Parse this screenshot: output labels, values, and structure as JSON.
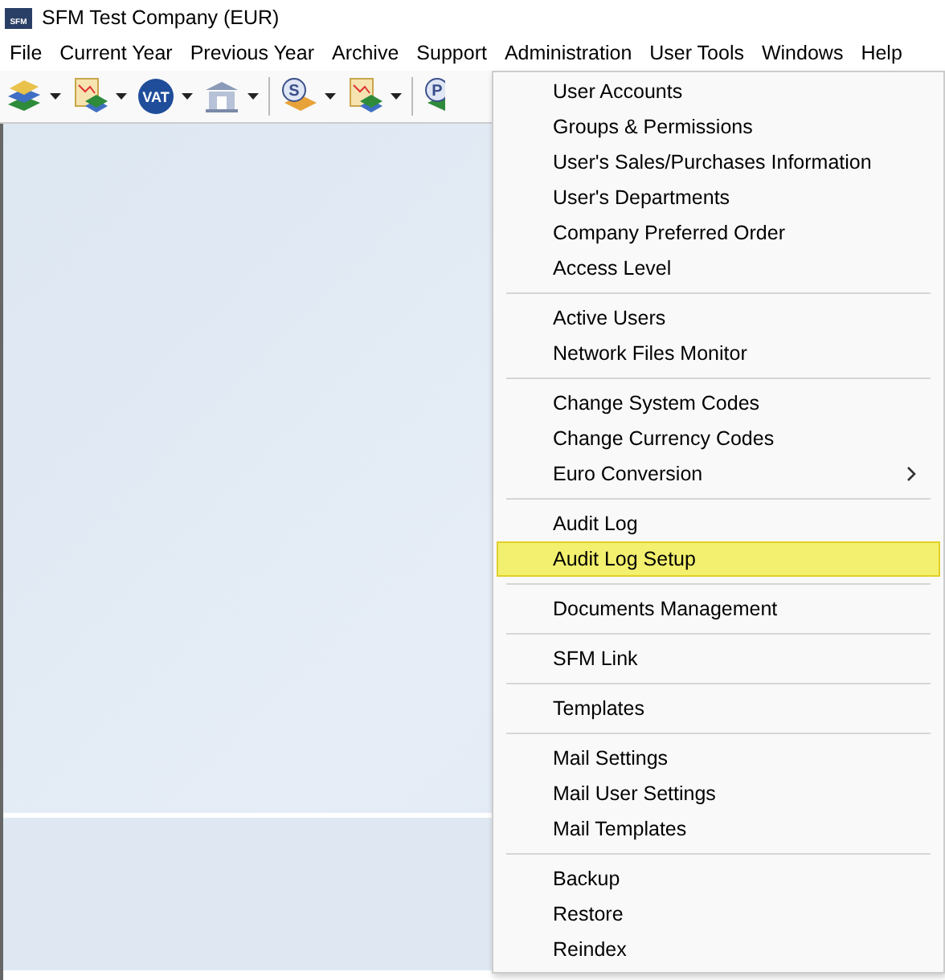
{
  "window": {
    "title": "SFM Test Company (EUR)",
    "logo_text": "SFM"
  },
  "menu_bar": [
    {
      "label": "File"
    },
    {
      "label": "Current Year"
    },
    {
      "label": "Previous Year"
    },
    {
      "label": "Archive"
    },
    {
      "label": "Support"
    },
    {
      "label": "Administration"
    },
    {
      "label": "User Tools"
    },
    {
      "label": "Windows"
    },
    {
      "label": "Help"
    }
  ],
  "toolbar": [
    {
      "kind": "books"
    },
    {
      "kind": "report"
    },
    {
      "kind": "vat",
      "label": "VAT"
    },
    {
      "kind": "bank"
    },
    {
      "kind": "separator"
    },
    {
      "kind": "letter-books",
      "label": "S"
    },
    {
      "kind": "report"
    },
    {
      "kind": "separator"
    },
    {
      "kind": "letter-books-partial",
      "label": "P"
    }
  ],
  "dropdown_menu": {
    "groups": [
      [
        {
          "label": "User Accounts",
          "selected": false,
          "submenu": false
        },
        {
          "label": "Groups & Permissions",
          "selected": false,
          "submenu": false
        },
        {
          "label": "User's Sales/Purchases Information",
          "selected": false,
          "submenu": false
        },
        {
          "label": "User's Departments",
          "selected": false,
          "submenu": false
        },
        {
          "label": "Company Preferred Order",
          "selected": false,
          "submenu": false
        },
        {
          "label": "Access Level",
          "selected": false,
          "submenu": false
        }
      ],
      [
        {
          "label": "Active Users",
          "selected": false,
          "submenu": false
        },
        {
          "label": "Network Files Monitor",
          "selected": false,
          "submenu": false
        }
      ],
      [
        {
          "label": "Change System Codes",
          "selected": false,
          "submenu": false
        },
        {
          "label": "Change Currency Codes",
          "selected": false,
          "submenu": false
        },
        {
          "label": "Euro Conversion",
          "selected": false,
          "submenu": true
        }
      ],
      [
        {
          "label": "Audit Log",
          "selected": false,
          "submenu": false
        },
        {
          "label": "Audit Log Setup",
          "selected": true,
          "submenu": false
        }
      ],
      [
        {
          "label": "Documents Management",
          "selected": false,
          "submenu": false
        }
      ],
      [
        {
          "label": "SFM Link",
          "selected": false,
          "submenu": false
        }
      ],
      [
        {
          "label": "Templates",
          "selected": false,
          "submenu": false
        }
      ],
      [
        {
          "label": "Mail Settings",
          "selected": false,
          "submenu": false
        },
        {
          "label": "Mail User Settings",
          "selected": false,
          "submenu": false
        },
        {
          "label": "Mail Templates",
          "selected": false,
          "submenu": false
        }
      ],
      [
        {
          "label": "Backup",
          "selected": false,
          "submenu": false
        },
        {
          "label": "Restore",
          "selected": false,
          "submenu": false
        },
        {
          "label": "Reindex",
          "selected": false,
          "submenu": false
        }
      ]
    ]
  }
}
